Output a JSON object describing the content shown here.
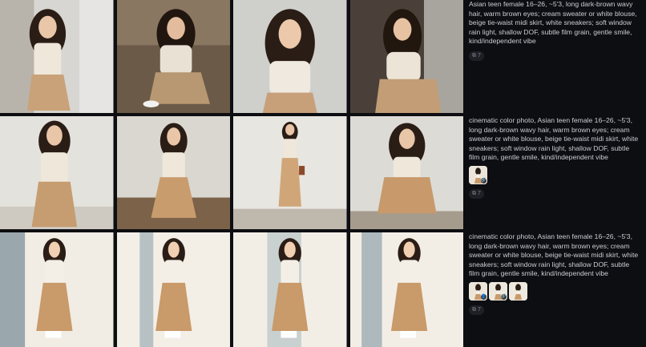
{
  "prompts": [
    {
      "text": "Asian teen female 16–26, ~5'3, long dark-brown wavy hair, warm brown eyes; cream sweater or white blouse, beige tie-waist midi skirt, white sneakers; soft window rain light, shallow DOF, subtle film grain, gentle smile, kind/independent vibe",
      "count": "7",
      "count_icon": "copy-icon"
    },
    {
      "text": "cinematic color photo, Asian teen female 16–26, ~5'3, long dark-brown wavy hair, warm brown eyes; cream sweater or white blouse, beige tie-waist midi skirt, white sneakers; soft window rain light, shallow DOF, subtle film grain, gentle smile, kind/independent vibe",
      "count": "7",
      "count_icon": "copy-icon",
      "refs": [
        {
          "badge": "🔗"
        }
      ]
    },
    {
      "text": "cinematic color photo, Asian teen female 16–26, ~5'3, long dark-brown wavy hair, warm brown eyes; cream sweater or white blouse, beige tie-waist midi skirt, white sneakers; soft window rain light, shallow DOF, subtle film grain, gentle smile, kind/independent vibe",
      "count": "7",
      "count_icon": "copy-icon",
      "refs": [
        {
          "badge": "👤"
        },
        {
          "badge": "🔗"
        },
        {
          "badge": ""
        }
      ]
    }
  ],
  "colors": {
    "background": "#0d0e11",
    "text": "#c9cdd4",
    "pill_bg": "#1e2025",
    "pill_text": "#7e838c",
    "hair": "#2a1d16",
    "skin": "#e9c6a8",
    "blouse": "#efe7da",
    "skirt": "#c9a27a"
  }
}
